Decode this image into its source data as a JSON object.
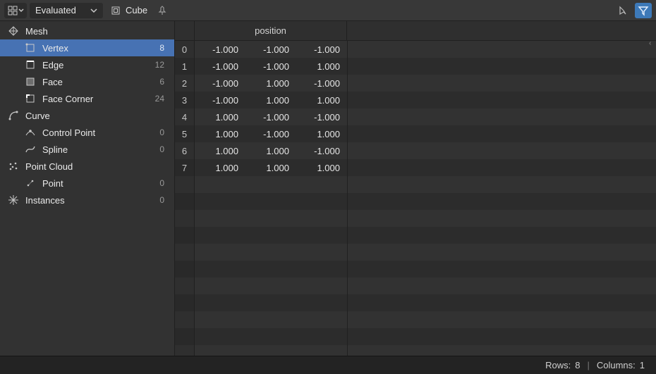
{
  "header": {
    "mode_select": "Evaluated",
    "object_name": "Cube"
  },
  "sidebar": {
    "groups": [
      {
        "id": "mesh",
        "label": "Mesh",
        "icon": "mesh-icon",
        "children": [
          {
            "id": "vertex",
            "label": "Vertex",
            "count": "8",
            "icon": "vertex-icon",
            "selected": true
          },
          {
            "id": "edge",
            "label": "Edge",
            "count": "12",
            "icon": "edge-icon"
          },
          {
            "id": "face",
            "label": "Face",
            "count": "6",
            "icon": "face-icon"
          },
          {
            "id": "face-corner",
            "label": "Face Corner",
            "count": "24",
            "icon": "face-corner-icon"
          }
        ]
      },
      {
        "id": "curve",
        "label": "Curve",
        "icon": "curve-icon",
        "children": [
          {
            "id": "control-point",
            "label": "Control Point",
            "count": "0",
            "icon": "control-point-icon"
          },
          {
            "id": "spline",
            "label": "Spline",
            "count": "0",
            "icon": "spline-icon"
          }
        ]
      },
      {
        "id": "point-cloud",
        "label": "Point Cloud",
        "icon": "point-cloud-icon",
        "children": [
          {
            "id": "point",
            "label": "Point",
            "count": "0",
            "icon": "point-icon"
          }
        ]
      },
      {
        "id": "instances",
        "label": "Instances",
        "count": "0",
        "icon": "instances-icon",
        "children": []
      }
    ]
  },
  "table": {
    "column_header": "position",
    "rows": [
      {
        "idx": "0",
        "x": "-1.000",
        "y": "-1.000",
        "z": "-1.000"
      },
      {
        "idx": "1",
        "x": "-1.000",
        "y": "-1.000",
        "z": "1.000"
      },
      {
        "idx": "2",
        "x": "-1.000",
        "y": "1.000",
        "z": "-1.000"
      },
      {
        "idx": "3",
        "x": "-1.000",
        "y": "1.000",
        "z": "1.000"
      },
      {
        "idx": "4",
        "x": "1.000",
        "y": "-1.000",
        "z": "-1.000"
      },
      {
        "idx": "5",
        "x": "1.000",
        "y": "-1.000",
        "z": "1.000"
      },
      {
        "idx": "6",
        "x": "1.000",
        "y": "1.000",
        "z": "-1.000"
      },
      {
        "idx": "7",
        "x": "1.000",
        "y": "1.000",
        "z": "1.000"
      }
    ],
    "empty_rows": 11
  },
  "footer": {
    "rows_label": "Rows:",
    "rows_value": "8",
    "columns_label": "Columns:",
    "columns_value": "1"
  }
}
